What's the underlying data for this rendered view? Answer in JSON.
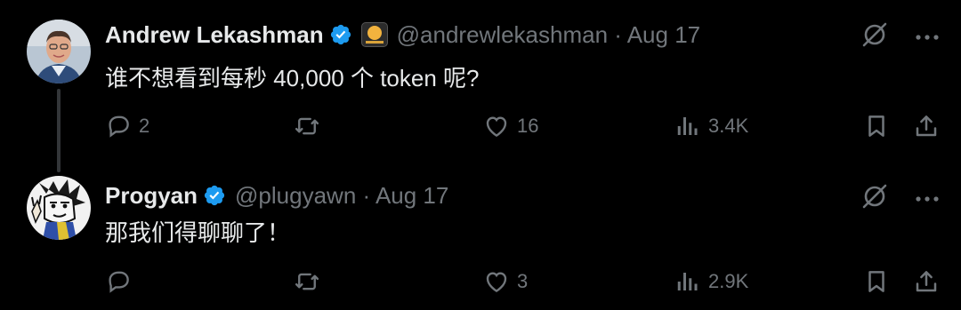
{
  "tweets": [
    {
      "name": "Andrew Lekashman",
      "handle": "@andrewlekashman · Aug 17",
      "text": "谁不想看到每秒 40,000 个 token 呢?",
      "replies": "2",
      "likes": "16",
      "views": "3.4K"
    },
    {
      "name": "Progyan",
      "handle": "@plugyawn · Aug 17",
      "text": "那我们得聊聊了！",
      "replies": "",
      "likes": "3",
      "views": "2.9K"
    }
  ],
  "colors": {
    "background": "#000000",
    "text": "#e7e9ea",
    "muted": "#71767b",
    "verified": "#1d9bf0",
    "thread_line": "#333639"
  },
  "icons": [
    "verified-badge-icon",
    "affiliate-badge-icon",
    "grok-icon",
    "more-icon",
    "reply-icon",
    "retweet-icon",
    "like-icon",
    "views-icon",
    "bookmark-icon",
    "share-icon"
  ]
}
